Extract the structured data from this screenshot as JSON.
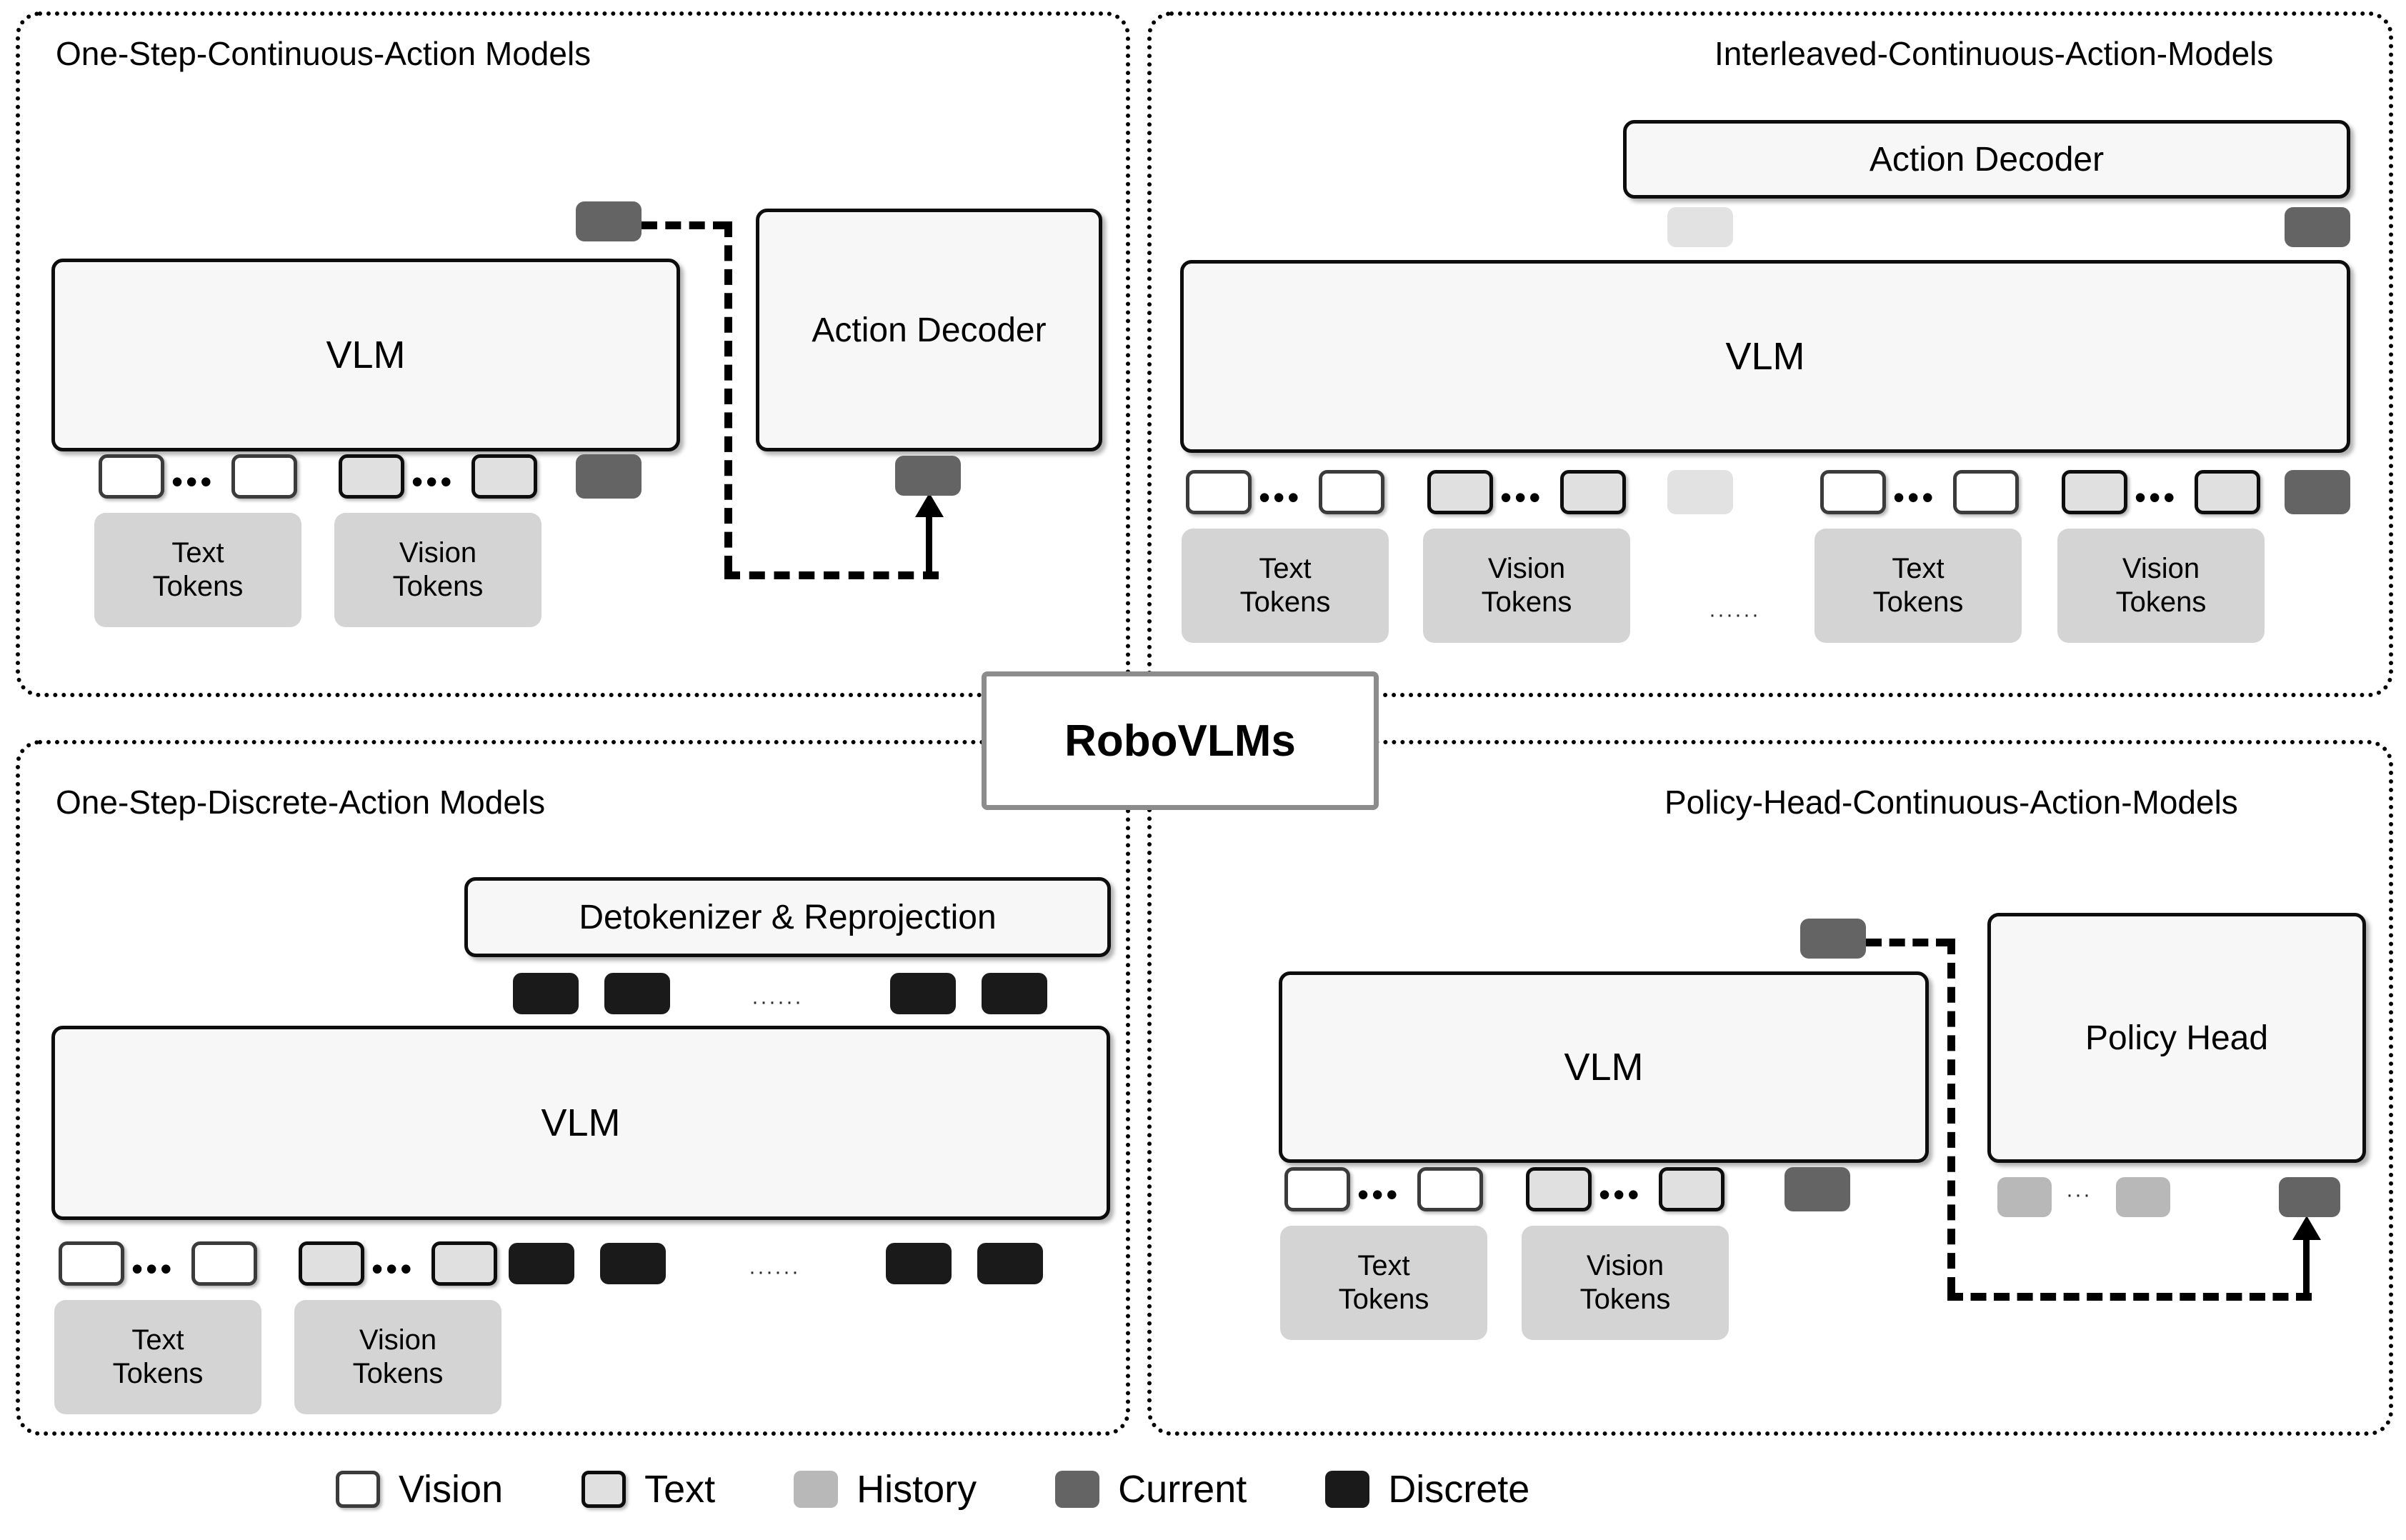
{
  "figure": {
    "center_badge": "RoboVLMs"
  },
  "quadrants": {
    "top_left": {
      "title": "One-Step-Continuous-Action Models",
      "vlm_label": "VLM",
      "decoder_label": "Action Decoder",
      "plates": [
        {
          "line1": "Text",
          "line2": "Tokens"
        },
        {
          "line1": "Vision",
          "line2": "Tokens"
        }
      ],
      "ellipsis": "•••",
      "tokens": [
        "vision",
        "vision",
        "text",
        "text",
        "current"
      ],
      "output_token": "current"
    },
    "top_right": {
      "title": "Interleaved-Continuous-Action-Models",
      "vlm_label": "VLM",
      "decoder_label": "Action Decoder",
      "plates": [
        {
          "line1": "Text",
          "line2": "Tokens"
        },
        {
          "line1": "Vision",
          "line2": "Tokens"
        },
        {
          "line1": "Text",
          "line2": "Tokens"
        },
        {
          "line1": "Vision",
          "line2": "Tokens"
        }
      ],
      "ellipsis": "•••",
      "step_ellipsis": "······",
      "tokens": [
        "vision",
        "vision",
        "text",
        "text",
        "historylight",
        "vision",
        "vision",
        "text",
        "text",
        "current"
      ],
      "decoder_inputs": [
        "historylight",
        "current"
      ]
    },
    "bottom_left": {
      "title": "One-Step-Discrete-Action Models",
      "vlm_label": "VLM",
      "detokenizer_label": "Detokenizer & Reprojection",
      "plates": [
        {
          "line1": "Text",
          "line2": "Tokens"
        },
        {
          "line1": "Vision",
          "line2": "Tokens"
        }
      ],
      "ellipsis": "•••",
      "series_ellipsis": "······",
      "output_tokens": [
        "discrete",
        "discrete",
        "discrete",
        "discrete"
      ],
      "input_tokens": [
        "vision",
        "vision",
        "text",
        "text",
        "discrete",
        "discrete",
        "discrete",
        "discrete"
      ]
    },
    "bottom_right": {
      "title": "Policy-Head-Continuous-Action-Models",
      "vlm_label": "VLM",
      "policy_head_label": "Policy Head",
      "plates": [
        {
          "line1": "Text",
          "line2": "Tokens"
        },
        {
          "line1": "Vision",
          "line2": "Tokens"
        }
      ],
      "ellipsis": "•••",
      "head_ellipsis": "···",
      "tokens": [
        "vision",
        "vision",
        "text",
        "text",
        "current"
      ],
      "head_tokens": [
        "history",
        "history",
        "current"
      ]
    }
  },
  "legend": {
    "items": [
      {
        "label": "Vision",
        "kind": "vision",
        "color": "#ffffff"
      },
      {
        "label": "Text",
        "kind": "text",
        "color": "#e0e0e0"
      },
      {
        "label": "History",
        "kind": "history",
        "color": "#b8b8b8"
      },
      {
        "label": "Current",
        "kind": "current",
        "color": "#646464"
      },
      {
        "label": "Discrete",
        "kind": "discrete",
        "color": "#1a1a1a"
      }
    ]
  }
}
